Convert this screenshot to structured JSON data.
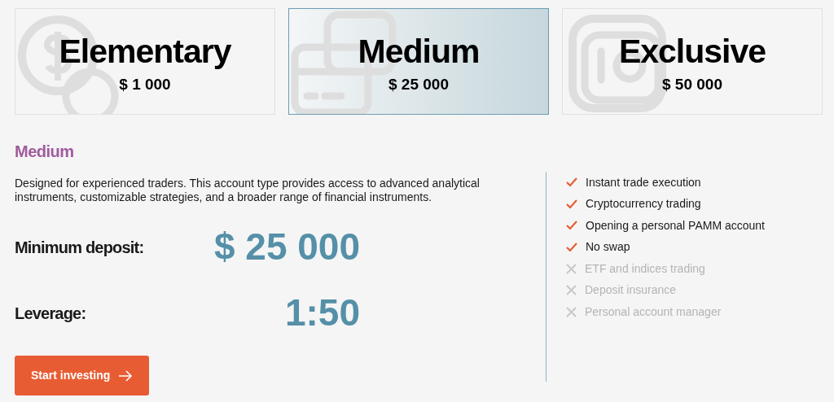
{
  "plans": [
    {
      "name": "Elementary",
      "price": "$ 1 000",
      "selected": false,
      "kind": "coins"
    },
    {
      "name": "Medium",
      "price": "$ 25 000",
      "selected": true,
      "kind": "card"
    },
    {
      "name": "Exclusive",
      "price": "$ 50 000",
      "selected": false,
      "kind": "safe"
    }
  ],
  "detail": {
    "title": "Medium",
    "description": "Designed for experienced traders. This account type provides access to advanced analytical instruments, customizable strategies, and a broader range of financial instruments.",
    "specs": [
      {
        "label": "Minimum deposit:",
        "value": "$ 25 000"
      },
      {
        "label": "Leverage:",
        "value": "1:50"
      }
    ],
    "button": "Start investing"
  },
  "features": [
    {
      "text": "Instant trade execution",
      "included": true
    },
    {
      "text": "Cryptocurrency trading",
      "included": true
    },
    {
      "text": "Opening a personal PAMM account",
      "included": true
    },
    {
      "text": "No swap",
      "included": true
    },
    {
      "text": "ETF and indices trading",
      "included": false
    },
    {
      "text": "Deposit insurance",
      "included": false
    },
    {
      "text": "Personal account manager",
      "included": false
    }
  ]
}
